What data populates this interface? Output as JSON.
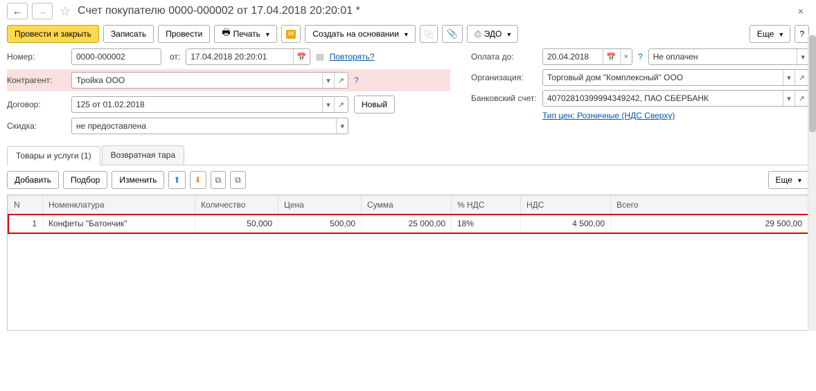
{
  "header": {
    "title": "Счет покупателю 0000-000002 от 17.04.2018 20:20:01 *"
  },
  "toolbar": {
    "post_close": "Провести и закрыть",
    "save": "Записать",
    "post": "Провести",
    "print": "Печать",
    "create_based": "Создать на основании",
    "edo": "ЭДО",
    "more": "Еще"
  },
  "form": {
    "number_label": "Номер:",
    "number": "0000-000002",
    "from_label": "от:",
    "date": "17.04.2018 20:20:01",
    "repeat": "Повторять?",
    "counterparty_label": "Контрагент:",
    "counterparty": "Тройка ООО",
    "contract_label": "Договор:",
    "contract": "125 от 01.02.2018",
    "new_btn": "Новый",
    "discount_label": "Скидка:",
    "discount": "не предоставлена",
    "pay_until_label": "Оплата до:",
    "pay_until": "20.04.2018",
    "pay_status": "Не оплачен",
    "org_label": "Организация:",
    "org": "Торговый дом \"Комплексный\" ООО",
    "bank_label": "Банковский счет:",
    "bank": "40702810399994349242, ПАО СБЕРБАНК",
    "price_type": "Тип цен: Розничные (НДС Сверху)"
  },
  "tabs": {
    "goods": "Товары и услуги (1)",
    "returnable": "Возвратная тара"
  },
  "tab_toolbar": {
    "add": "Добавить",
    "pick": "Подбор",
    "edit": "Изменить",
    "more": "Еще"
  },
  "table": {
    "cols": {
      "n": "N",
      "nomenclature": "Номенклатура",
      "qty": "Количество",
      "price": "Цена",
      "sum": "Сумма",
      "vat_rate": "% НДС",
      "vat": "НДС",
      "total": "Всего"
    },
    "rows": [
      {
        "n": "1",
        "nomenclature": "Конфеты \"Батончик\"",
        "qty": "50,000",
        "price": "500,00",
        "sum": "25 000,00",
        "vat_rate": "18%",
        "vat": "4 500,00",
        "total": "29 500,00"
      }
    ]
  }
}
